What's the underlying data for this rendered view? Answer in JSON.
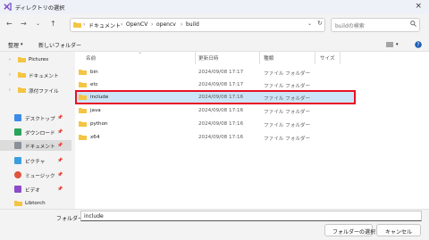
{
  "window": {
    "title": "ディレクトリの選択"
  },
  "breadcrumb": [
    "ドキュメント",
    "OpenCV",
    "opencv",
    "build"
  ],
  "search": {
    "placeholder": "buildの検索"
  },
  "toolbar": {
    "organize": "整理",
    "new_folder": "新しいフォルダー"
  },
  "sidebar": [
    {
      "label": "Pictures",
      "type": "folder"
    },
    {
      "label": "ドキュメント",
      "type": "folder"
    },
    {
      "label": "添付ファイル",
      "type": "folder"
    },
    {
      "label": "デスクトップ",
      "type": "desktop"
    },
    {
      "label": "ダウンロード",
      "type": "download"
    },
    {
      "label": "ドキュメント",
      "type": "document",
      "selected": true
    },
    {
      "label": "ピクチャ",
      "type": "picture"
    },
    {
      "label": "ミュージック",
      "type": "music"
    },
    {
      "label": "ビデオ",
      "type": "video"
    },
    {
      "label": "Libtorch",
      "type": "folder"
    }
  ],
  "columns": {
    "name": "名前",
    "date": "更新日時",
    "type": "種類",
    "size": "サイズ"
  },
  "rows": [
    {
      "name": "bin",
      "date": "2024/09/08 17:17",
      "type": "ファイル フォルダー"
    },
    {
      "name": "etc",
      "date": "2024/09/08 17:17",
      "type": "ファイル フォルダー"
    },
    {
      "name": "include",
      "date": "2024/09/08 17:16",
      "type": "ファイル フォルダー",
      "selected": true
    },
    {
      "name": "java",
      "date": "2024/09/08 17:16",
      "type": "ファイル フォルダー"
    },
    {
      "name": "python",
      "date": "2024/09/08 17:16",
      "type": "ファイル フォルダー"
    },
    {
      "name": "x64",
      "date": "2024/09/08 17:16",
      "type": "ファイル フォルダー"
    }
  ],
  "footer": {
    "folder_label": "フォルダー:",
    "folder_value": "include",
    "select_button": "フォルダーの選択",
    "cancel_button": "キャンセル"
  },
  "colors": {
    "selection": "#cce4f7",
    "highlight": "#e81123",
    "folder": "#f4c542"
  }
}
